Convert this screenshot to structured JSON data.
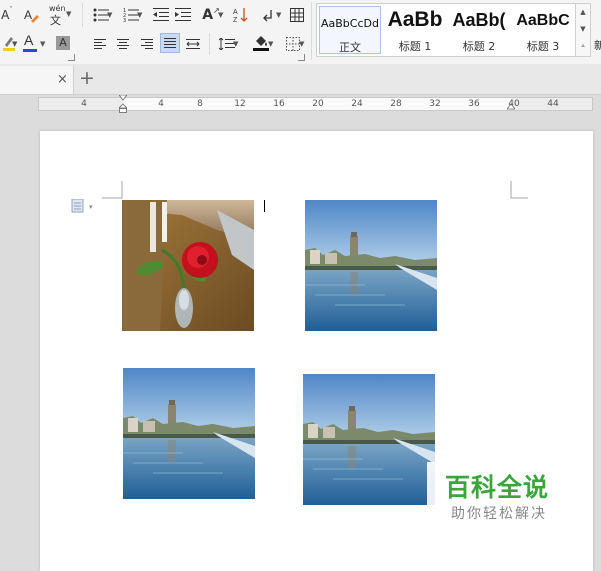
{
  "ribbon": {
    "font_size_up_glyph": "A",
    "pinyin_glyph": "wén",
    "char_border_glyph": "A",
    "text_effect_glyph": "A",
    "font_color_glyph": "A",
    "char_shading_glyph": "A",
    "highlight_color": "#f5d000",
    "font_color": "#1f4fd8",
    "styles": [
      {
        "sample": "AaBbCcDd",
        "name": "正文"
      },
      {
        "sample": "AaBb",
        "name": "标题 1"
      },
      {
        "sample": "AaBb(",
        "name": "标题 2"
      },
      {
        "sample": "AaBbC",
        "name": "标题 3"
      }
    ],
    "styles_overflow_label": "新"
  },
  "tab": {
    "close_glyph": "×",
    "new_glyph": "+"
  },
  "ruler": {
    "ticks": [
      "4",
      "4",
      "8",
      "12",
      "16",
      "20",
      "24",
      "28",
      "32",
      "36",
      "40",
      "44"
    ]
  },
  "document": {
    "images": [
      {
        "subject": "red rose in a glass vase on a wooden table"
      },
      {
        "subject": "river with pagoda and town skyline under blue sky"
      },
      {
        "subject": "river with pagoda and town skyline under blue sky"
      },
      {
        "subject": "river with pagoda and town skyline under blue sky"
      }
    ]
  },
  "watermark": {
    "title": "百科全说",
    "subtitle": "助你轻松解决",
    "color": "#3aa53c"
  },
  "icons": [
    "paragraph-mark-icon",
    "bullets-icon",
    "numbering-icon",
    "indent-icon",
    "outdent-icon",
    "sort-icon",
    "align-left-icon",
    "align-center-icon",
    "align-right-icon",
    "justify-icon",
    "distribute-icon",
    "line-spacing-icon",
    "fill-bucket-icon",
    "border-icon",
    "table-icon",
    "close-icon",
    "plus-icon"
  ]
}
